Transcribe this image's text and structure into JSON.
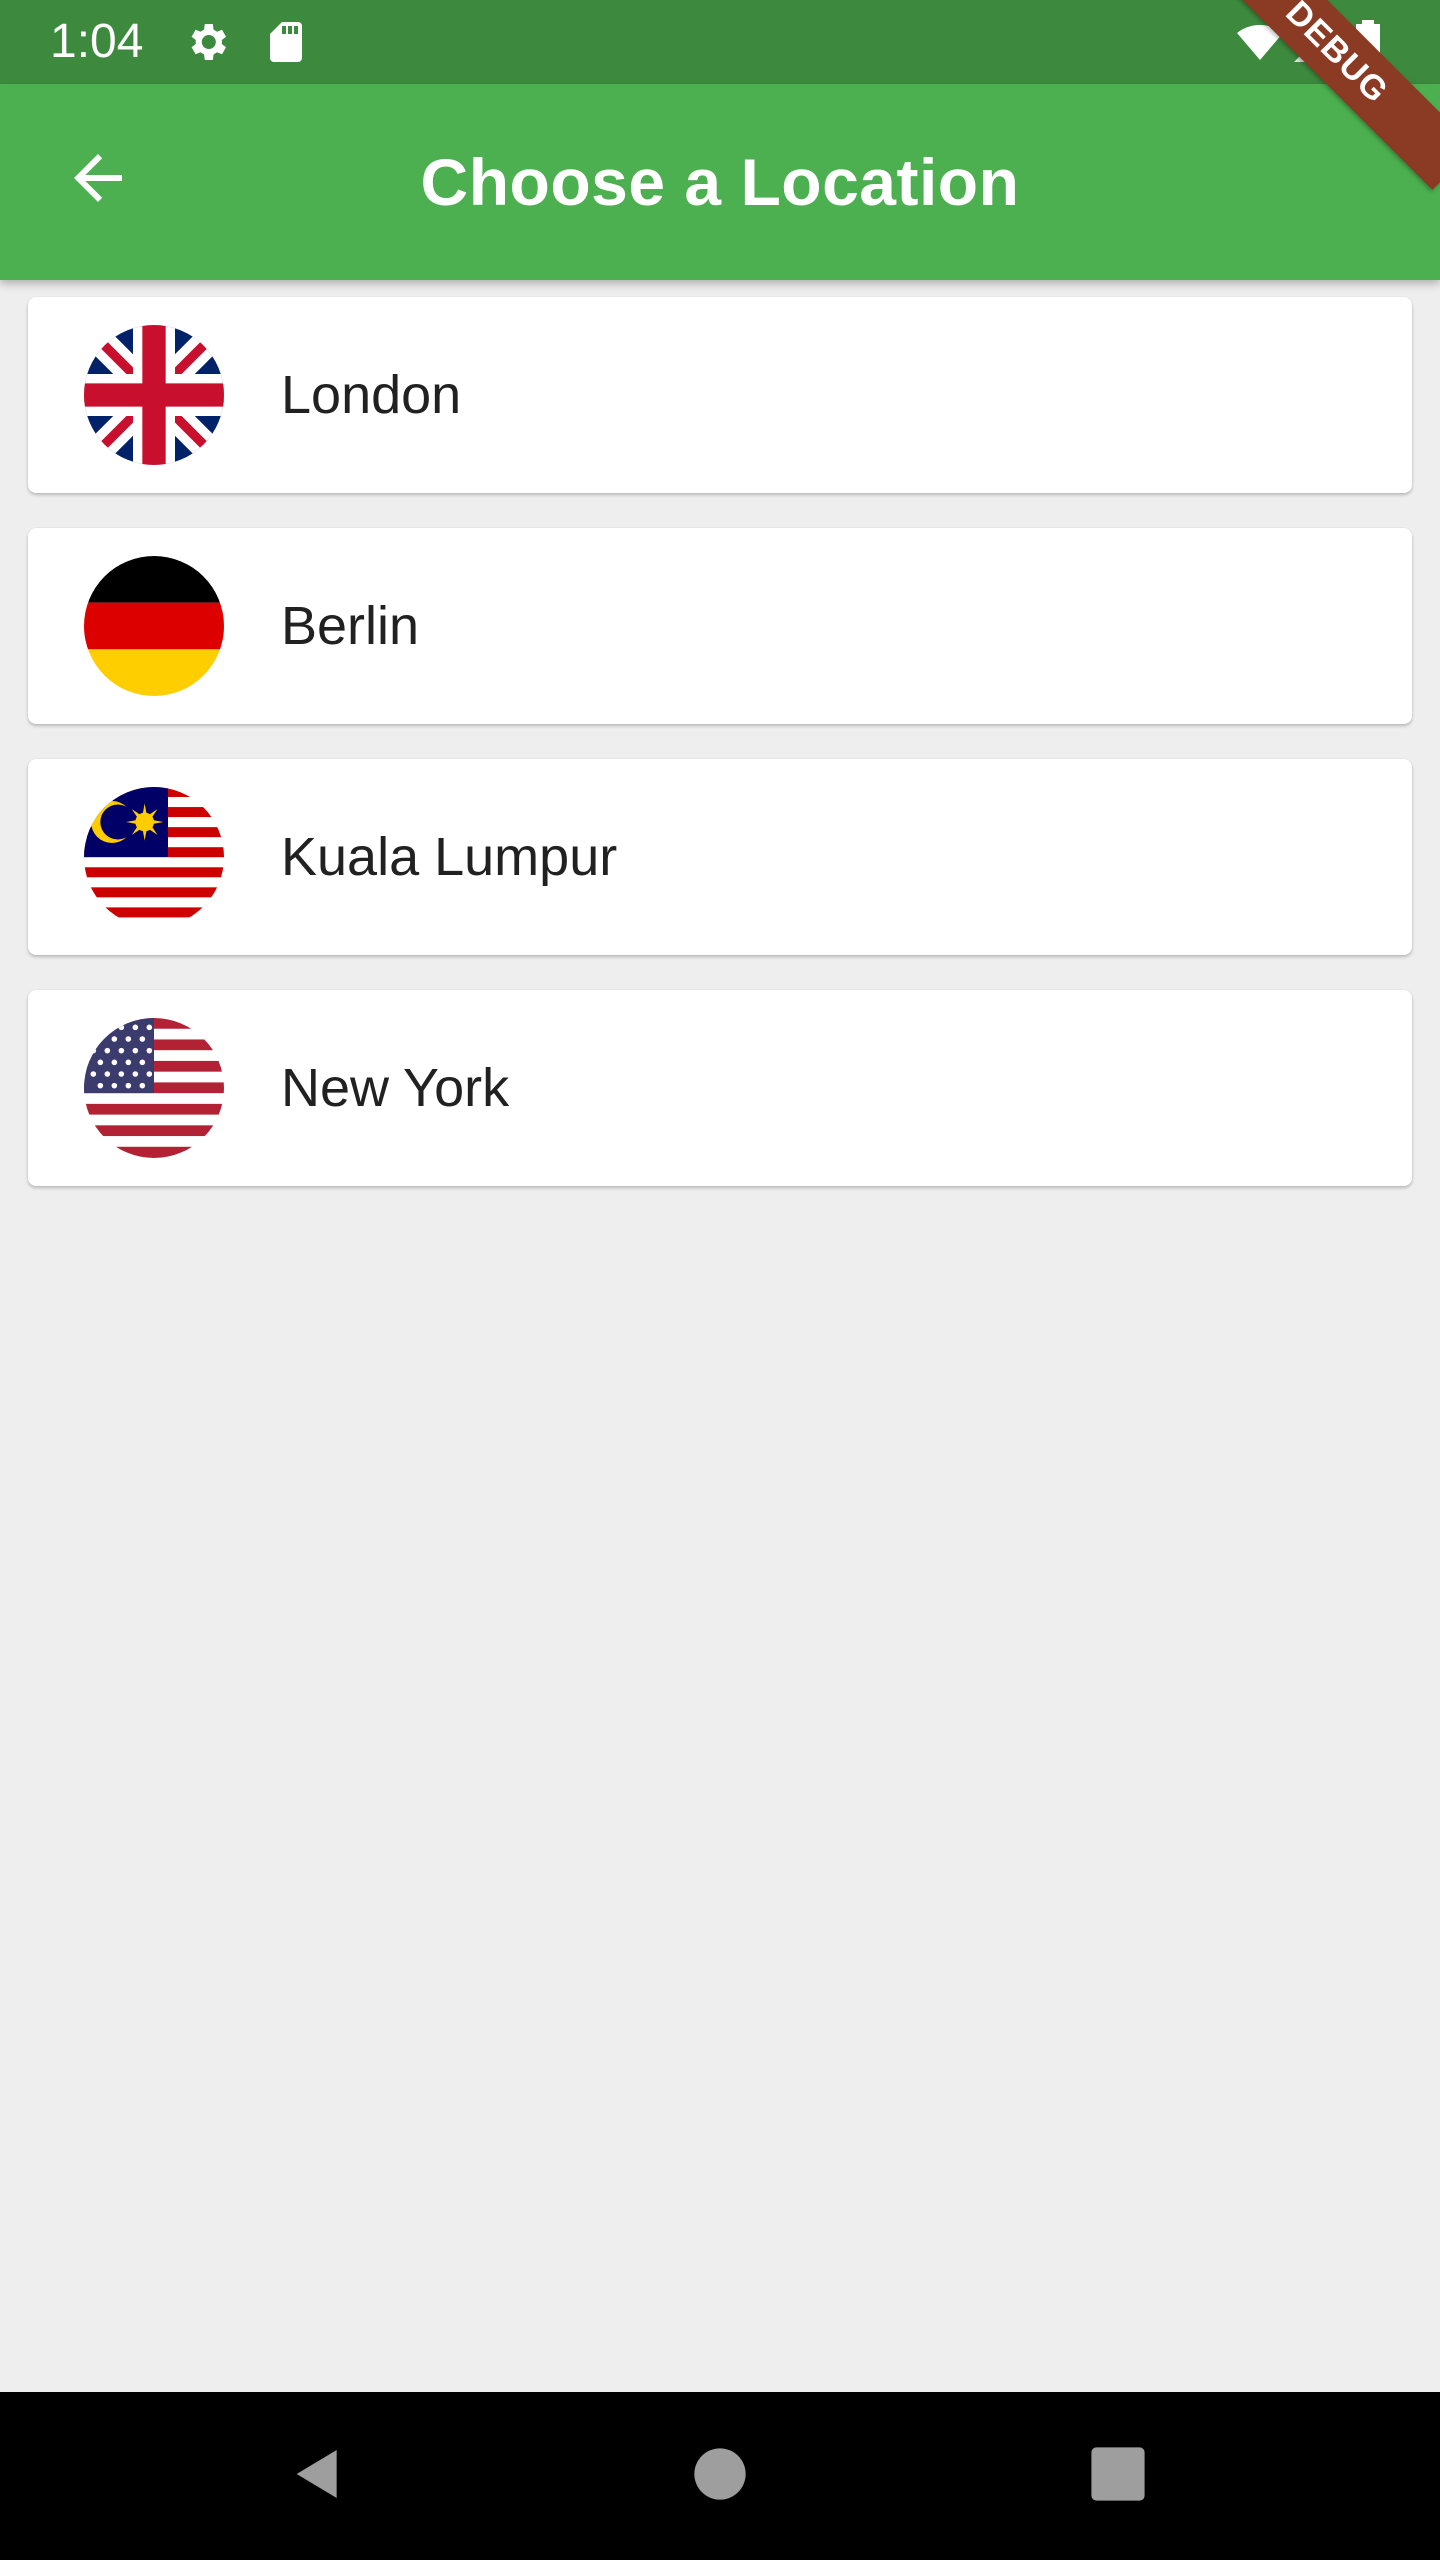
{
  "status_bar": {
    "time": "1:04",
    "icons": [
      "gear-icon",
      "sd-card-icon",
      "wifi-icon",
      "signal-icon",
      "battery-icon"
    ]
  },
  "app_bar": {
    "title": "Choose a Location",
    "back_icon": "arrow-back-icon",
    "background": "#4caf50"
  },
  "debug_banner": "DEBUG",
  "locations": [
    {
      "name": "London",
      "flag": "uk-flag-icon"
    },
    {
      "name": "Berlin",
      "flag": "germany-flag-icon"
    },
    {
      "name": "Kuala Lumpur",
      "flag": "malaysia-flag-icon"
    },
    {
      "name": "New York",
      "flag": "usa-flag-icon"
    }
  ],
  "nav_bar": {
    "buttons": [
      "nav-back-icon",
      "nav-home-icon",
      "nav-recents-icon"
    ]
  },
  "colors": {
    "status_bar": "#3d8a3f",
    "app_bar": "#4caf50",
    "background": "#eeeeee",
    "card": "#ffffff"
  }
}
